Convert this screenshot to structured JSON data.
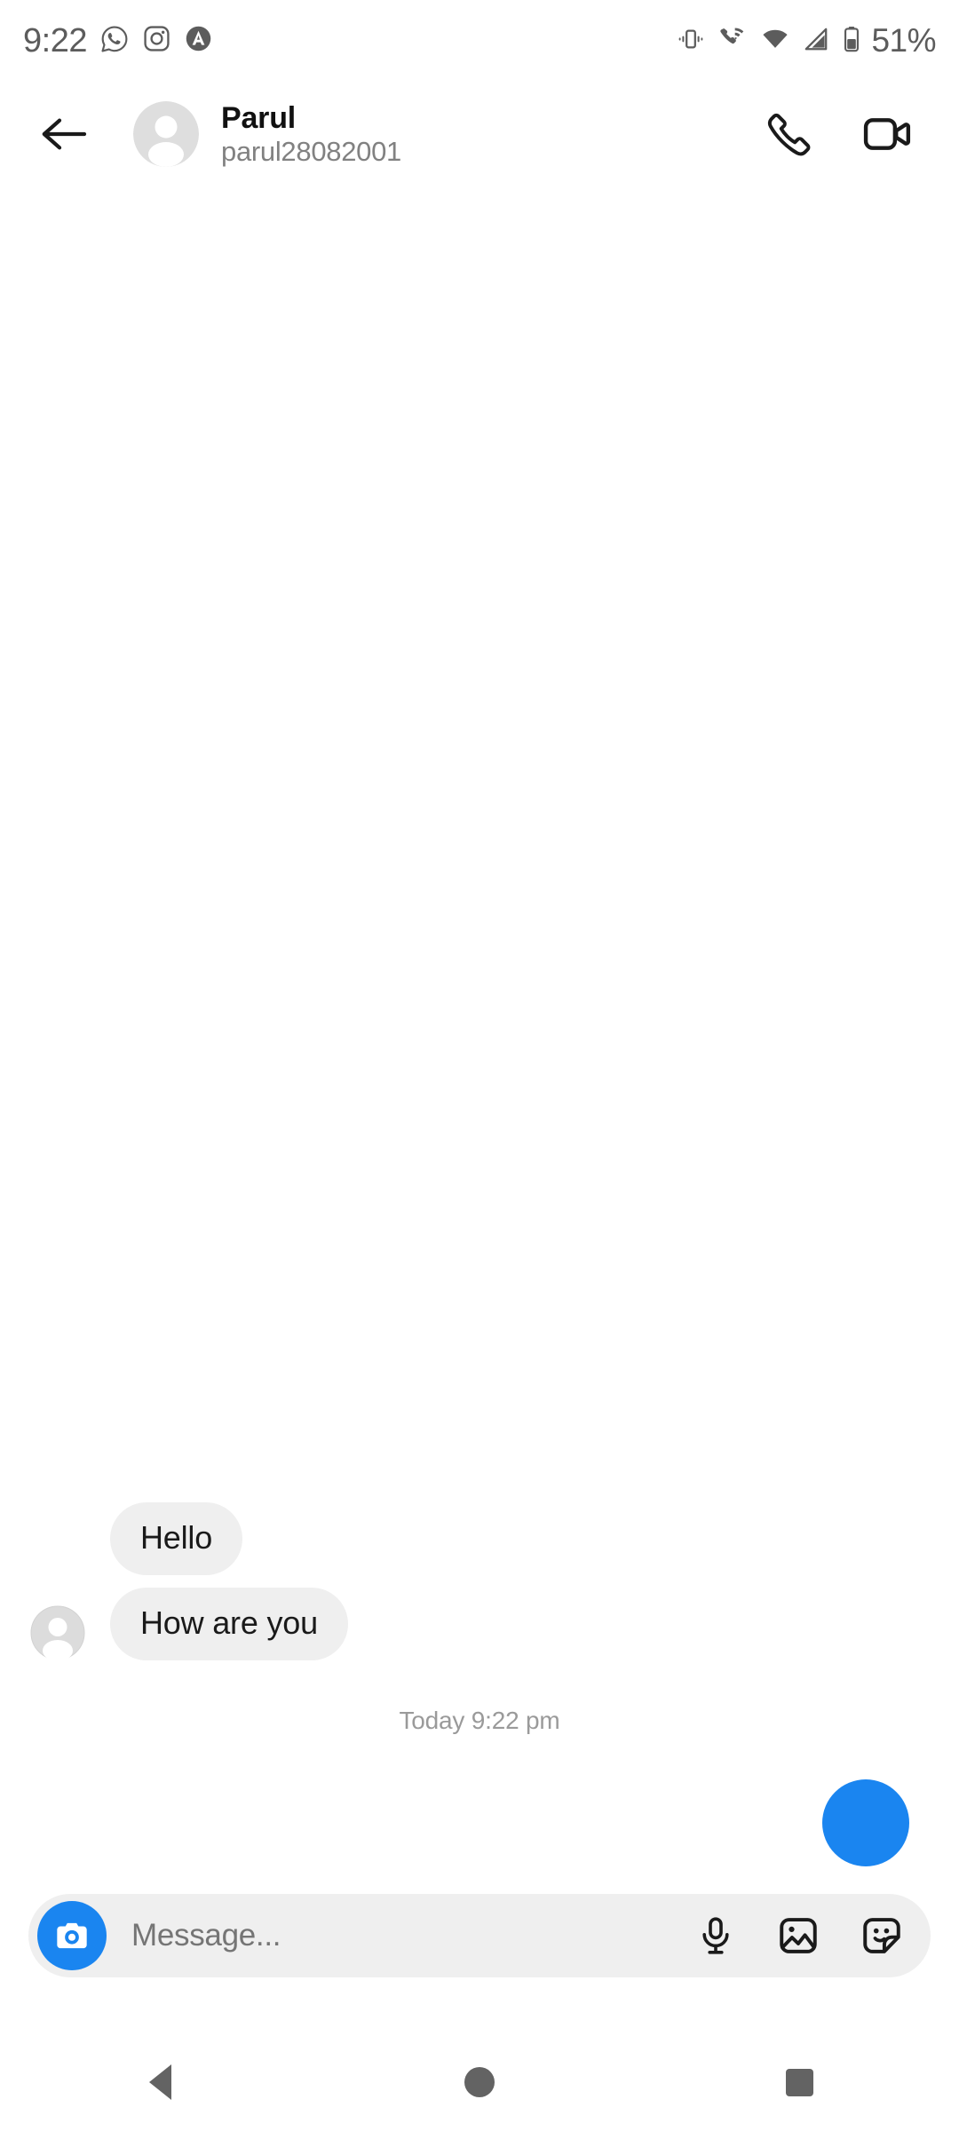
{
  "status_bar": {
    "time": "9:22",
    "battery_percent": "51%",
    "notification_icons": [
      "whatsapp-icon",
      "instagram-icon",
      "app-a-icon"
    ],
    "system_icons": [
      "vibrate-icon",
      "vowifi-icon",
      "wifi-icon",
      "cellular-signal-icon",
      "battery-icon"
    ],
    "icon_color": "#5c5c5c"
  },
  "header": {
    "back_label": "back-arrow",
    "name": "Parul",
    "username": "parul28082001",
    "avatar": "default-profile-avatar",
    "actions": [
      {
        "name": "audio-call",
        "icon": "phone-icon"
      },
      {
        "name": "video-call",
        "icon": "video-camera-icon"
      }
    ]
  },
  "conversation": {
    "messages": [
      {
        "id": "msg-1",
        "text": "Hello",
        "direction": "incoming",
        "show_avatar": false
      },
      {
        "id": "msg-2",
        "text": "How are you",
        "direction": "incoming",
        "show_avatar": true
      }
    ],
    "timestamp": "Today 9:22 pm",
    "sent_media": {
      "type": "blue-circle",
      "color": "#1a85f0"
    },
    "bubble_color": "#efefef",
    "bubble_text_color": "#1a1a1a"
  },
  "input_bar": {
    "camera_button": "camera-icon",
    "camera_button_color": "#1a85f0",
    "placeholder": "Message...",
    "value": "",
    "actions": [
      {
        "name": "voice-message",
        "icon": "microphone-icon"
      },
      {
        "name": "gallery",
        "icon": "image-icon"
      },
      {
        "name": "sticker",
        "icon": "sticker-icon"
      }
    ]
  },
  "nav_bar": {
    "buttons": [
      {
        "name": "back",
        "icon": "triangle-icon"
      },
      {
        "name": "home",
        "icon": "circle-icon"
      },
      {
        "name": "recents",
        "icon": "square-icon"
      }
    ],
    "color": "#636363"
  }
}
